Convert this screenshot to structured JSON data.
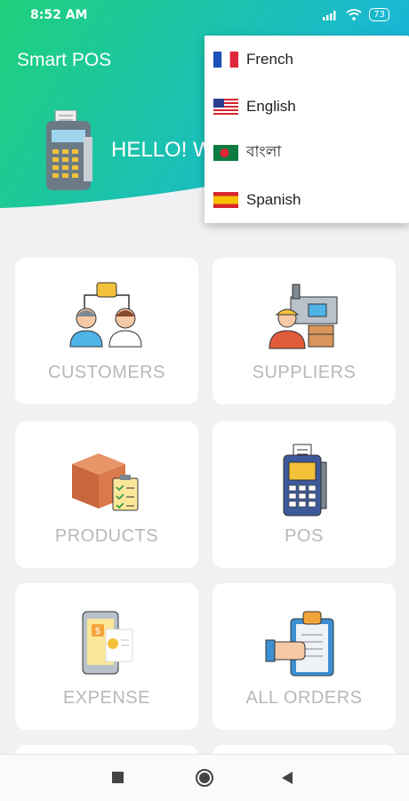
{
  "status_bar": {
    "time": "8:52 AM",
    "battery": "73"
  },
  "app": {
    "title": "Smart POS",
    "greeting": "HELLO! W"
  },
  "colors": {
    "gradient_start": "#1fd17b",
    "gradient_end": "#1ab6d8",
    "label": "#b8b8b8",
    "background": "#f1f1f3"
  },
  "tiles": [
    {
      "label": "CUSTOMERS",
      "icon": "customers-icon"
    },
    {
      "label": "SUPPLIERS",
      "icon": "suppliers-icon"
    },
    {
      "label": "PRODUCTS",
      "icon": "products-icon"
    },
    {
      "label": "POS",
      "icon": "pos-terminal-icon"
    },
    {
      "label": "EXPENSE",
      "icon": "expense-icon"
    },
    {
      "label": "ALL ORDERS",
      "icon": "orders-icon"
    }
  ],
  "language_menu": {
    "items": [
      {
        "label": "French",
        "flag": "france-flag-icon"
      },
      {
        "label": "English",
        "flag": "usa-flag-icon"
      },
      {
        "label": "বাংলা",
        "flag": "bangladesh-flag-icon"
      },
      {
        "label": "Spanish",
        "flag": "spain-flag-icon"
      }
    ]
  },
  "nav": {
    "buttons": [
      "recents-button",
      "home-button",
      "back-button"
    ]
  }
}
